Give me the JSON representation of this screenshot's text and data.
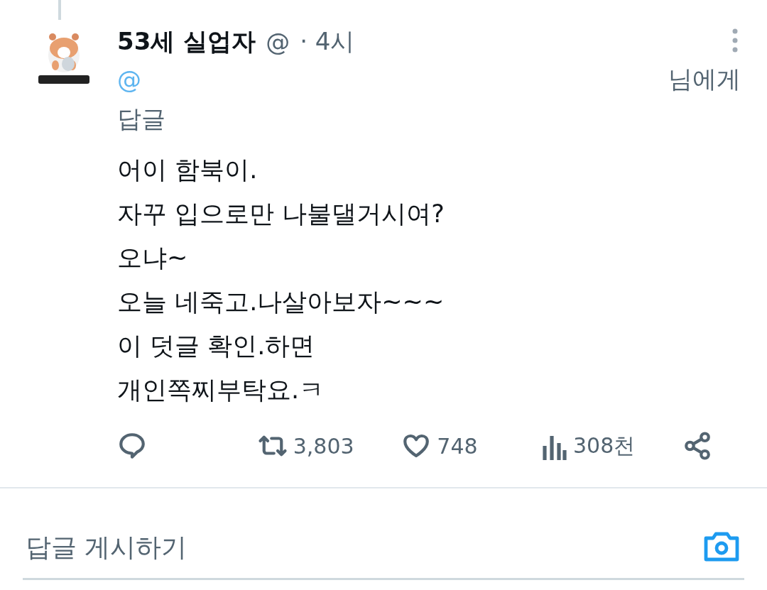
{
  "tweet": {
    "name": "53세 실업자",
    "handle": "@",
    "time": "· 4시",
    "reply_to": {
      "handle": "@",
      "suffix": "님에게",
      "label": "답글"
    },
    "body": [
      "어이 함북이.",
      "자꾸 입으로만 나불댈거시여?",
      "오냐~",
      "오늘 네죽고.나살아보자~~~",
      "이 덧글 확인.하면",
      "개인쪽찌부탁요.ㅋ"
    ],
    "actions": [
      {
        "kind": "reply"
      },
      {
        "kind": "retweet",
        "count": "3,803"
      },
      {
        "kind": "like",
        "count": "748"
      },
      {
        "kind": "views",
        "count": "308천"
      },
      {
        "kind": "share"
      }
    ]
  },
  "composer": {
    "placeholder": "답글 게시하기"
  }
}
